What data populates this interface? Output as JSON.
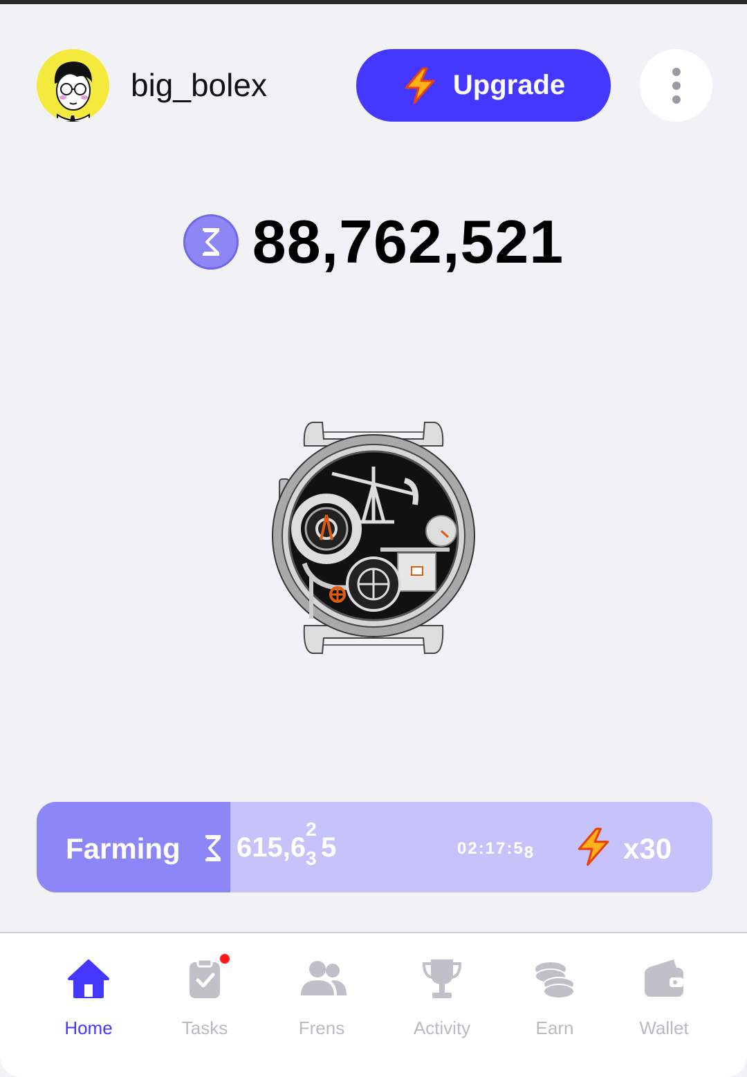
{
  "header": {
    "username": "big_bolex",
    "upgrade_label": "Upgrade",
    "brand_color": "#4437ff"
  },
  "balance": {
    "amount": "88,762,521",
    "token_icon": "hourglass-token-icon"
  },
  "farming": {
    "label": "Farming",
    "amount_main": "615,6",
    "amount_tail": "5",
    "amount_roll_top": "2",
    "amount_roll_bottom": "3",
    "timer": "02:17:5",
    "timer_last": "8",
    "multiplier": "x30",
    "progress": 0.287
  },
  "nav": {
    "items": [
      {
        "label": "Home",
        "icon": "home-icon",
        "active": true
      },
      {
        "label": "Tasks",
        "icon": "tasks-clipboard-icon",
        "active": false,
        "badge": true
      },
      {
        "label": "Frens",
        "icon": "friends-icon",
        "active": false
      },
      {
        "label": "Activity",
        "icon": "trophy-icon",
        "active": false
      },
      {
        "label": "Earn",
        "icon": "coins-icon",
        "active": false
      },
      {
        "label": "Wallet",
        "icon": "wallet-icon",
        "active": false
      }
    ]
  }
}
